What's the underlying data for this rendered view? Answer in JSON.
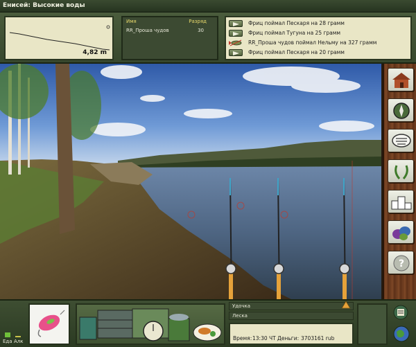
{
  "window": {
    "title": "Енисей: Высокие воды"
  },
  "depth": {
    "value": "4,82 m"
  },
  "scoreboard": {
    "col_name": "Имя",
    "col_rank": "Разряд",
    "rows": [
      {
        "name": "RR_Проша чудов",
        "rank": "30"
      }
    ]
  },
  "feed": {
    "messages": [
      "Фриц поймал Пескаря на 28 грамм",
      "Фриц поймал Тугуна на 25 грамм",
      "RR_Проша чудов поймал Нельму на 327 грамм",
      "Фриц поймал Пескаря на 20 грамм"
    ]
  },
  "meters": {
    "food_label": "Еда",
    "alcohol_label": "Алк",
    "food_level": 0.15,
    "alcohol_level": 0.05
  },
  "tackle": {
    "rod_label": "Удочка",
    "line_label": "Леска"
  },
  "status": {
    "time_label": "Время:",
    "time_value": "13:30 ЧТ",
    "money_label": "Деньги:",
    "money_value": "3703161 rub"
  },
  "sidebar": {
    "buttons": [
      "base-house",
      "compass",
      "chat",
      "laurel-wreath",
      "podium",
      "fish-species",
      "help"
    ]
  },
  "colors": {
    "panel_green": "#3c4a32",
    "parchment": "#e9e6c6",
    "scoreboard_header": "#e8d96b",
    "wood": "#6a3a1e",
    "bite_alarm": "#e6a23a"
  }
}
